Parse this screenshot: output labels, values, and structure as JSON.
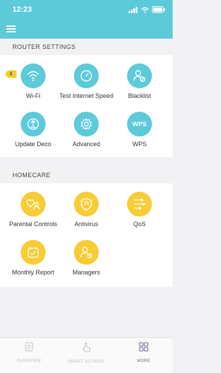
{
  "status_bar": {
    "time": "12:23"
  },
  "router_settings": {
    "title": "ROUTER SETTINGS",
    "items": [
      {
        "label": "Wi-Fi",
        "icon": "wifi-icon"
      },
      {
        "label": "Test Internet Speed",
        "icon": "speedometer-icon"
      },
      {
        "label": "Blacklist",
        "icon": "user-block-icon"
      },
      {
        "label": "Update Deco",
        "icon": "update-icon"
      },
      {
        "label": "Advanced",
        "icon": "gear-icon"
      },
      {
        "label": "WPS",
        "icon": "wps-icon",
        "icon_text": "WPS"
      }
    ],
    "wifi_badge": "1"
  },
  "homecare": {
    "title": "HOMECARE",
    "items": [
      {
        "label": "Parental Controls",
        "icon": "family-icon"
      },
      {
        "label": "Antivirus",
        "icon": "shield-icon"
      },
      {
        "label": "QoS",
        "icon": "qos-icon"
      },
      {
        "label": "Monthly Report",
        "icon": "calendar-icon"
      },
      {
        "label": "Managers",
        "icon": "user-gear-icon"
      }
    ]
  },
  "bottom_nav": {
    "items": [
      {
        "label": "OVERVIEW",
        "icon": "document-icon",
        "active": false
      },
      {
        "label": "SMART ACTIONS",
        "icon": "tap-icon",
        "active": false
      },
      {
        "label": "MORE",
        "icon": "grid-icon",
        "active": true
      }
    ]
  },
  "colors": {
    "accent": "#5ccad9",
    "homecare": "#f7cc36",
    "active_nav": "#6b6b9a"
  }
}
